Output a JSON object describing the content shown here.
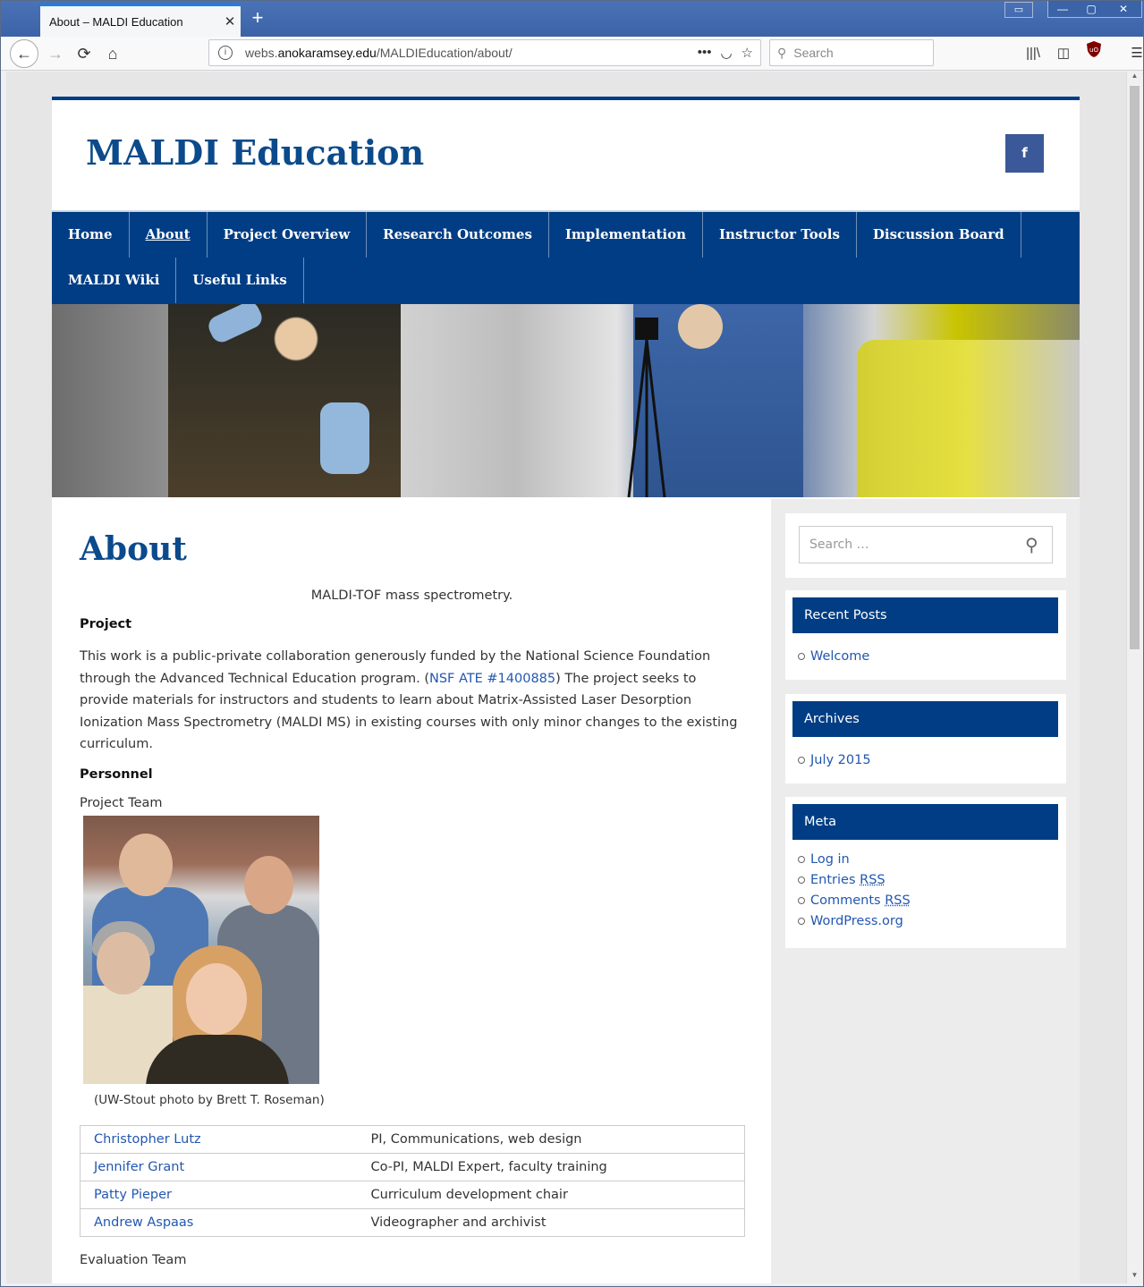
{
  "browser": {
    "tab_title": "About – MALDI Education",
    "tab_close": "✕",
    "new_tab": "+",
    "url_prefix": "webs.",
    "url_domain": "anokaramsey.edu",
    "url_path": "/MALDIEducation/about/",
    "search_placeholder": "Search"
  },
  "site": {
    "title": "MALDI Education",
    "facebook_label": "f",
    "nav": [
      "Home",
      "About",
      "Project Overview",
      "Research Outcomes",
      "Implementation",
      "Instructor Tools",
      "Discussion Board",
      "MALDI Wiki",
      "Useful Links"
    ],
    "active_nav": "About"
  },
  "page": {
    "title": "About",
    "hero_caption": "MALDI-TOF mass spectrometry.",
    "project_heading": "Project",
    "project_text_1": "This work is a public-private collaboration generously funded by the National Science Foundation through the Advanced Technical Education program.  (",
    "project_link": "NSF ATE #1400885",
    "project_text_2": ") The project seeks to provide materials for instructors and students to learn about Matrix-Assisted Laser Desorption Ionization Mass Spectrometry (MALDI MS) in existing courses with only minor changes to the existing curriculum.",
    "personnel_heading": "Personnel",
    "project_team_label": "Project Team",
    "photo_caption": "(UW-Stout photo by Brett T. Roseman)",
    "team": [
      {
        "name": "Christopher Lutz",
        "role": "PI, Communications, web design"
      },
      {
        "name": "Jennifer Grant",
        "role": "Co-PI, MALDI Expert, faculty training"
      },
      {
        "name": "Patty Pieper",
        "role": "Curriculum development chair"
      },
      {
        "name": "Andrew Aspaas",
        "role": "Videographer and archivist"
      }
    ],
    "evaluation_team_label": "Evaluation Team"
  },
  "sidebar": {
    "search_placeholder": "Search …",
    "recent_posts_title": "Recent Posts",
    "recent_posts": [
      "Welcome"
    ],
    "archives_title": "Archives",
    "archives": [
      "July 2015"
    ],
    "meta_title": "Meta",
    "meta_login": "Log in",
    "meta_entries": "Entries ",
    "meta_comments": "Comments ",
    "meta_rss": "RSS",
    "meta_wordpress": "WordPress.org"
  },
  "colors": {
    "brand_blue": "#003d84",
    "link_blue": "#2257b0",
    "facebook": "#3b5998"
  }
}
